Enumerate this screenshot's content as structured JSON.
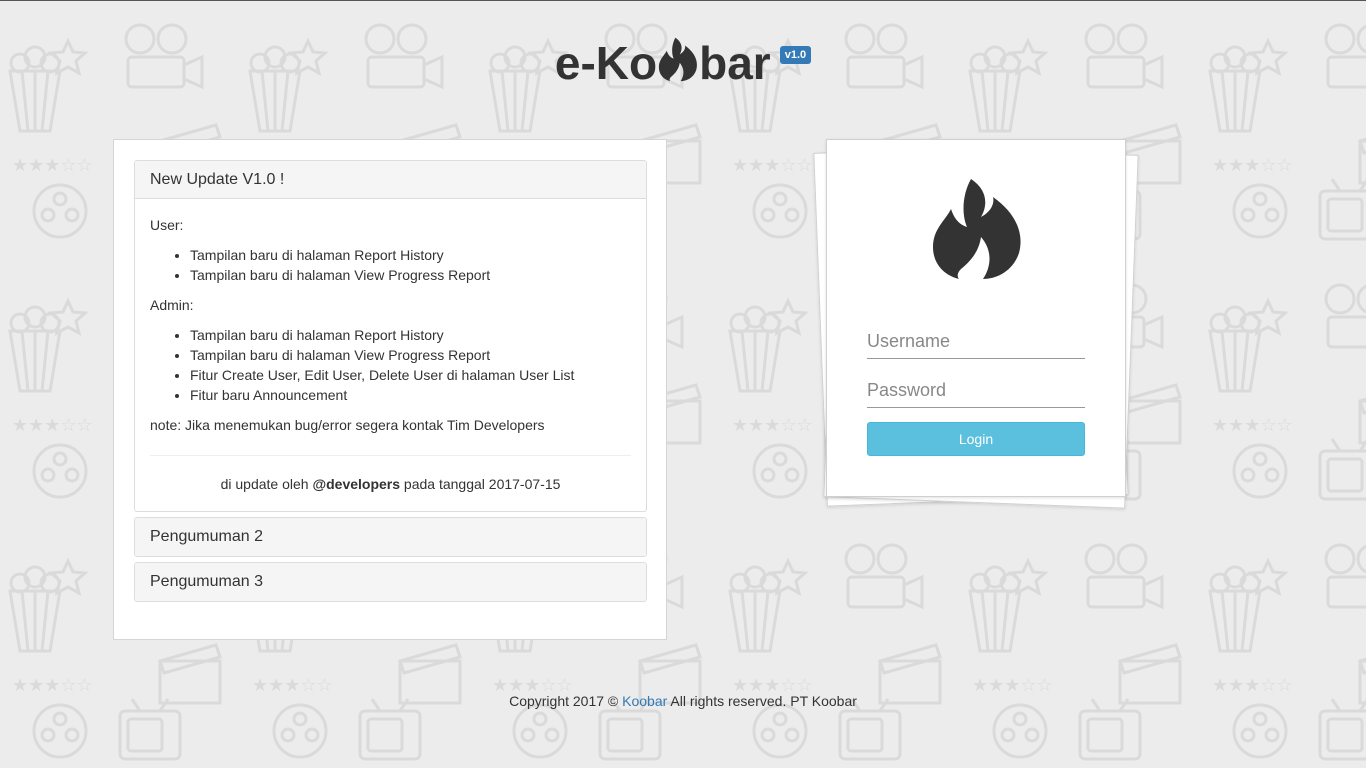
{
  "brand": {
    "text_before": "e-Ko",
    "text_after": "bar",
    "version": "v1.0",
    "logo_icon": "flame-icon"
  },
  "news": {
    "open_item": {
      "title": "New Update V1.0 !",
      "user_heading": "User:",
      "user_items": [
        "Tampilan baru di halaman Report History",
        "Tampilan baru di halaman View Progress Report"
      ],
      "admin_heading": "Admin:",
      "admin_items": [
        "Tampilan baru di halaman Report History",
        "Tampilan baru di halaman View Progress Report",
        "Fitur Create User, Edit User, Delete User di halaman User List",
        "Fitur baru Announcement"
      ],
      "note": "note: Jika menemukan bug/error segera kontak Tim Developers",
      "updated_prefix": "di update oleh",
      "updated_by": "@developers",
      "updated_mid": "pada tanggal",
      "updated_date": "2017-07-15"
    },
    "collapsed_items": [
      "Pengumuman 2",
      "Pengumuman 3"
    ]
  },
  "login": {
    "logo_icon": "flame-icon",
    "username_placeholder": "Username",
    "password_placeholder": "Password",
    "button_label": "Login"
  },
  "footer": {
    "prefix": "Copyright 2017 ©",
    "link": "Koobar",
    "suffix": "All rights reserved. PT Koobar"
  },
  "colors": {
    "background": "#ececec",
    "brand_badge": "#337ab7",
    "login_button": "#5bc0de",
    "link": "#337ab7"
  }
}
